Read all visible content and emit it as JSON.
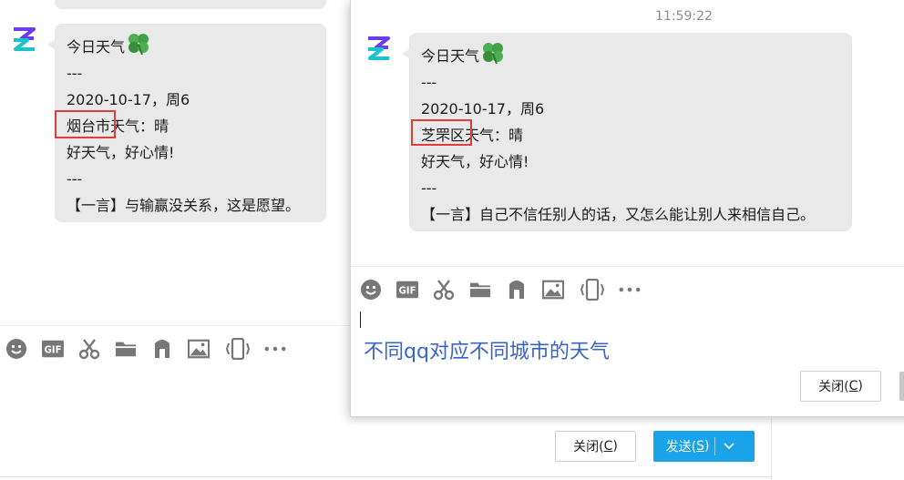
{
  "back_window": {
    "message": {
      "title": "今日天气",
      "sep1": "---",
      "date": "2020-10-17，周6",
      "city": "烟台市",
      "weather_suffix": "天气：晴",
      "mood": "好天气，好心情!",
      "sep2": "---",
      "quote": "【一言】与输赢没关系，这是愿望。"
    },
    "toolbar": [
      "emoji-icon",
      "gif-icon",
      "scissors-icon",
      "folder-icon",
      "music-icon",
      "image-icon",
      "phone-shake-icon",
      "more-icon"
    ],
    "close_label": "关闭(",
    "close_key": "C",
    "close_end": ")",
    "send_label": "发送(",
    "send_key": "S",
    "send_end": ")"
  },
  "front_window": {
    "timestamp": "11:59:22",
    "message": {
      "title": "今日天气",
      "sep1": "---",
      "date": "2020-10-17，周6",
      "city": "芝罘区",
      "weather_suffix": "天气：晴",
      "mood": "好天气，好心情!",
      "sep2": "---",
      "quote": "【一言】自己不信任别人的话，又怎么能让别人来相信自己。"
    },
    "toolbar": [
      "emoji-icon",
      "gif-icon",
      "scissors-icon",
      "folder-icon",
      "music-icon",
      "image-icon",
      "phone-shake-icon",
      "more-icon"
    ],
    "caption": "不同qq对应不同城市的天气",
    "close_label": "关闭(",
    "close_key": "C",
    "close_end": ")"
  },
  "colors": {
    "bubble": "#e9e9e9",
    "highlight": "#e23c3c",
    "caption": "#3a63c9",
    "send_button": "#1aa3e8"
  }
}
